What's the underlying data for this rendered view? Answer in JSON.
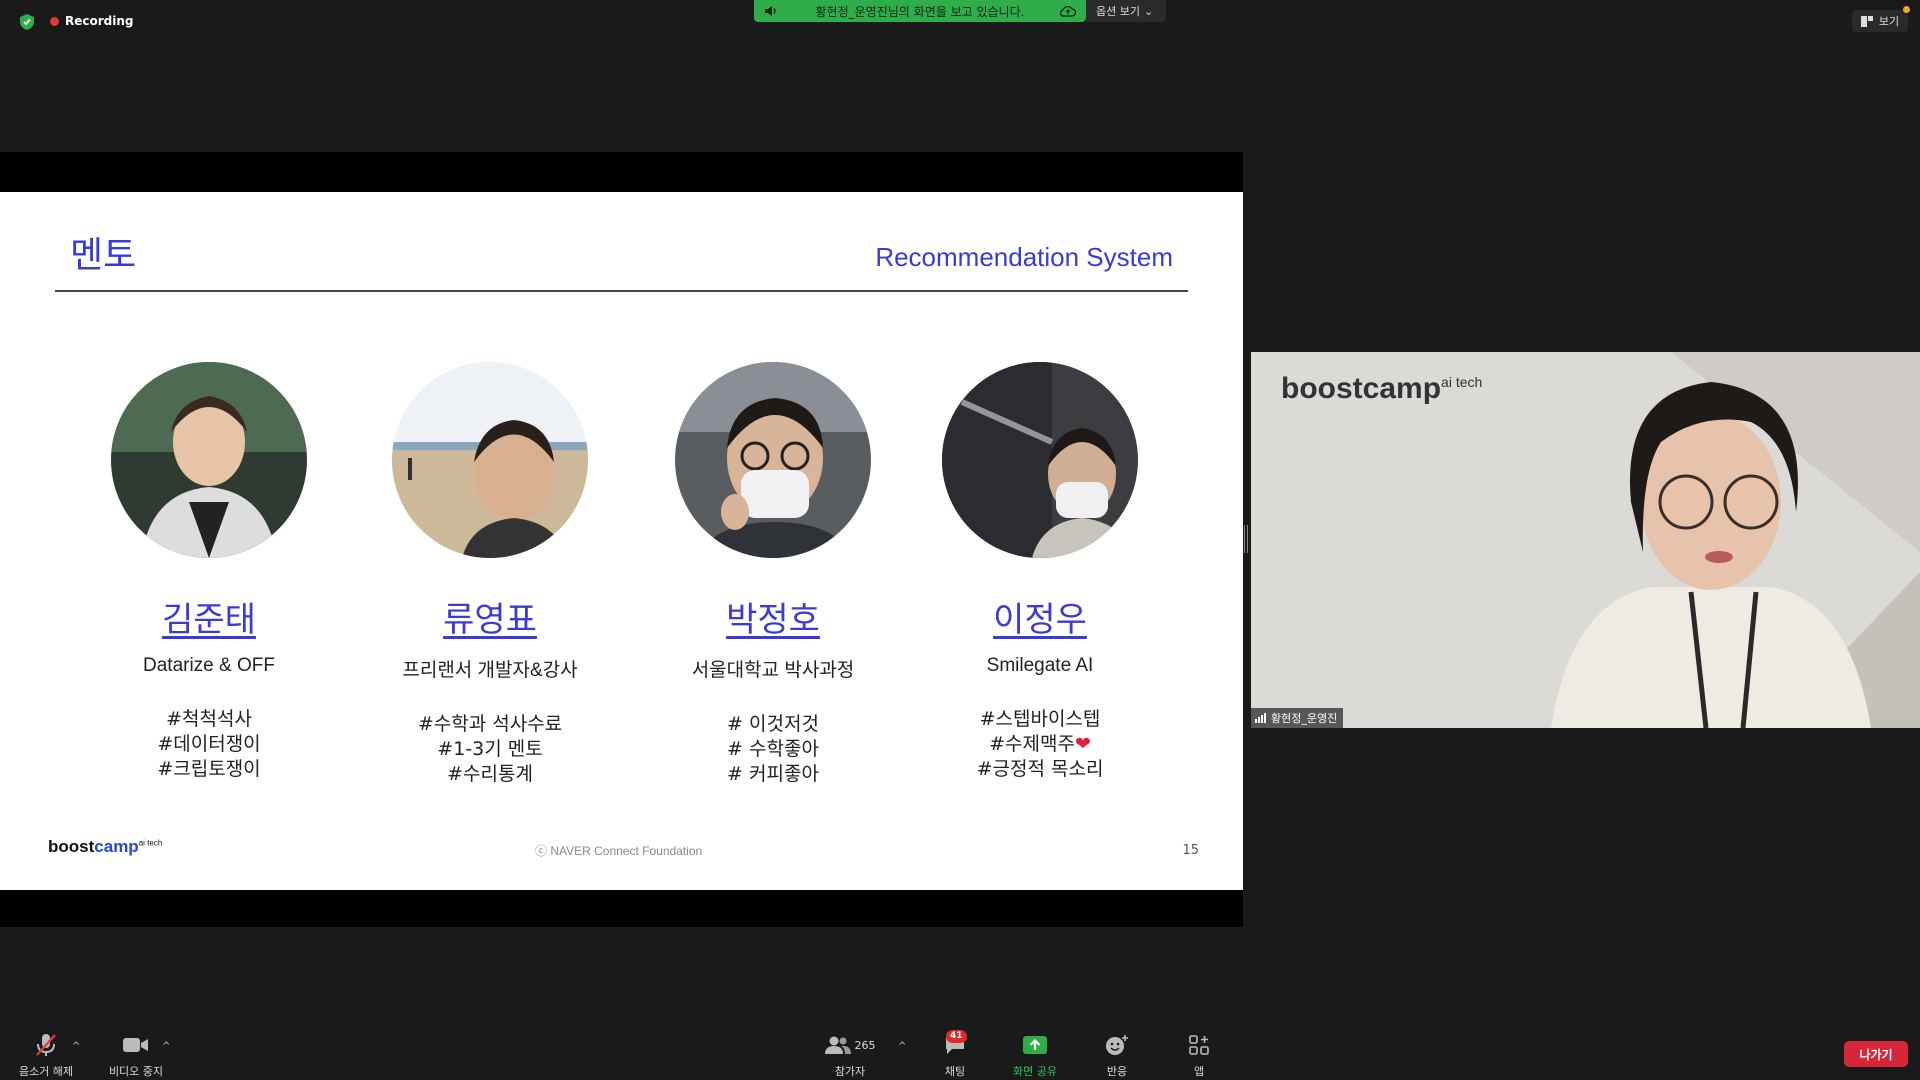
{
  "topbar": {
    "recording_label": "Recording",
    "share_banner_text": "황현정_운영진님의 화면을 보고 있습니다.",
    "view_options_label": "옵션 보기",
    "view_label": "보기"
  },
  "slide": {
    "title": "멘토",
    "subtitle": "Recommendation System",
    "mentors": [
      {
        "name": "김준태",
        "affiliation": "Datarize & OFF",
        "tags": [
          "#척척석사",
          "#데이터쟁이",
          "#크립토쟁이"
        ]
      },
      {
        "name": "류영표",
        "affiliation": "프리랜서 개발자&강사",
        "tags": [
          "#수학과 석사수료",
          "#1-3기 멘토",
          "#수리통계"
        ]
      },
      {
        "name": "박정호",
        "affiliation": "서울대학교 박사과정",
        "tags": [
          "# 이것저것",
          "# 수학좋아",
          "# 커피좋아"
        ]
      },
      {
        "name": "이정우",
        "affiliation": "Smilegate AI",
        "tags": [
          "#스텝바이스텝",
          "#수제맥주",
          "#긍정적 목소리"
        ],
        "tag2_suffix": "❤"
      }
    ],
    "footer_logo_main": "boost",
    "footer_logo_accent": "camp",
    "footer_logo_sup": "ai tech",
    "footer_copyright": "ⓒ  NAVER Connect Foundation",
    "page_number": "15"
  },
  "video": {
    "background_logo": "boostcamp",
    "background_logo_sup": "ai tech",
    "participant_name": "황현정_운영진"
  },
  "toolbar": {
    "unmute_label": "음소거 해제",
    "stop_video_label": "비디오 중지",
    "participants_label": "참가자",
    "participants_count": "265",
    "chat_label": "채팅",
    "chat_badge": "41",
    "share_label": "화면 공유",
    "reactions_label": "반응",
    "apps_label": "앱",
    "leave_label": "나가기"
  },
  "colors": {
    "accent_blue": "#3a3ad8",
    "share_green": "#2ead4a",
    "recording_red": "#e53935",
    "leave_red": "#d6263a"
  }
}
